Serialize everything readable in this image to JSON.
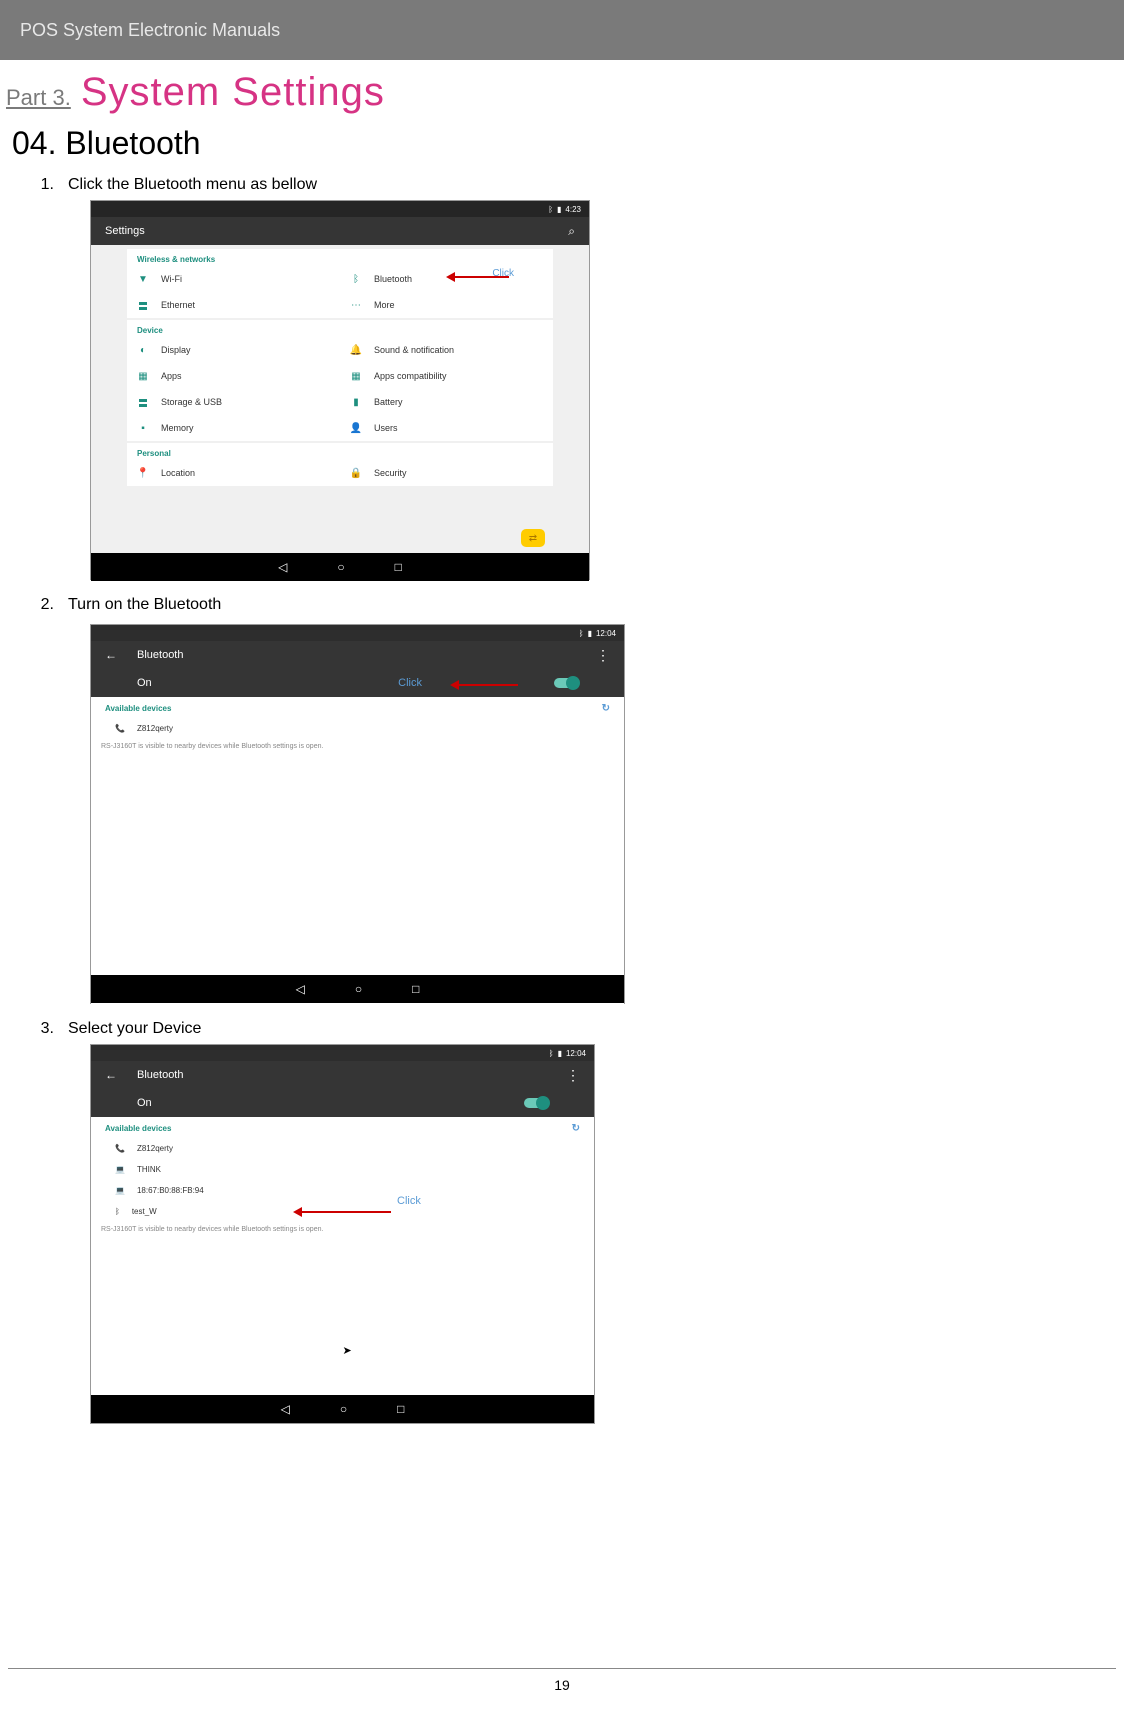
{
  "header": {
    "title": "POS System Electronic  Manuals"
  },
  "title": {
    "part": "Part  3.",
    "main": "System  Settings"
  },
  "section": "04.  Bluetooth",
  "steps": [
    {
      "num": "1.",
      "text": "Click the Bluetooth menu as bellow"
    },
    {
      "num": "2.",
      "text": "Turn on the Bluetooth"
    },
    {
      "num": "3.",
      "text": "Select your Device"
    }
  ],
  "ss1": {
    "status_time": "4:23",
    "title": "Settings",
    "categories": {
      "wireless": {
        "label": "Wireless & networks",
        "items": [
          [
            "Wi-Fi",
            "Bluetooth"
          ],
          [
            "Ethernet",
            "More"
          ]
        ]
      },
      "device": {
        "label": "Device",
        "items": [
          [
            "Display",
            "Sound & notification"
          ],
          [
            "Apps",
            "Apps compatibility"
          ],
          [
            "Storage & USB",
            "Battery"
          ],
          [
            "Memory",
            "Users"
          ]
        ]
      },
      "personal": {
        "label": "Personal",
        "items": [
          [
            "Location",
            "Security"
          ]
        ]
      }
    },
    "click": "Click"
  },
  "ss2": {
    "status_time": "12:04",
    "title": "Bluetooth",
    "state": "On",
    "avail_label": "Available devices",
    "devices": [
      "Z812qerty"
    ],
    "footer_note": "RS-J3160T is visible to nearby devices while Bluetooth settings is open.",
    "click": "Click"
  },
  "ss3": {
    "status_time": "12:04",
    "title": "Bluetooth",
    "state": "On",
    "avail_label": "Available devices",
    "devices": [
      "Z812qerty",
      "THINK",
      "18:67:B0:88:FB:94",
      "test_W"
    ],
    "footer_note": "RS-J3160T is visible to nearby devices while Bluetooth settings is open.",
    "click": "Click"
  },
  "page_number": "19"
}
